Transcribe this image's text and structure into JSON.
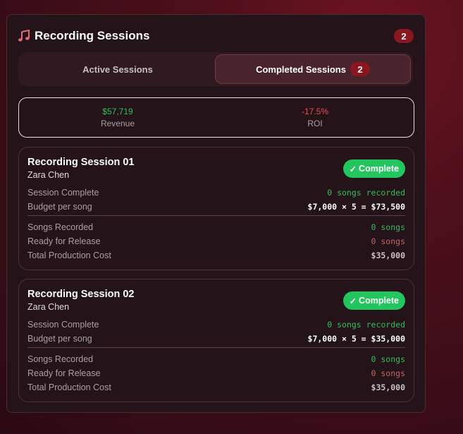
{
  "header": {
    "title": "Recording Sessions",
    "count": "2",
    "icon": "music-note-icon"
  },
  "tabs": [
    {
      "label": "Active Sessions",
      "active": false
    },
    {
      "label": "Completed Sessions",
      "badge": "2",
      "active": true
    }
  ],
  "stats": [
    {
      "value": "$57,719",
      "label": "Revenue",
      "color": "#2fbf5c"
    },
    {
      "value": "-17.5%",
      "label": "ROI",
      "color": "#e0505a"
    }
  ],
  "sessions": [
    {
      "title": "Recording Session 01",
      "artist": "Zara Chen",
      "status": "Complete",
      "status_color": "#22c55e",
      "session_complete_label": "Session Complete",
      "session_complete_value": "0 songs recorded",
      "budget_label": "Budget per song",
      "budget_value": "$7,000 × 5 = $73,500",
      "songs_recorded_label": "Songs Recorded",
      "songs_recorded_value": "0 songs",
      "ready_label": "Ready for Release",
      "ready_value": "0 songs",
      "cost_label": "Total Production Cost",
      "cost_value": "$35,000"
    },
    {
      "title": "Recording Session 02",
      "artist": "Zara Chen",
      "status": "Complete",
      "status_color": "#22c55e",
      "session_complete_label": "Session Complete",
      "session_complete_value": "0 songs recorded",
      "budget_label": "Budget per song",
      "budget_value": "$7,000 × 5 = $35,000",
      "songs_recorded_label": "Songs Recorded",
      "songs_recorded_value": "0 songs",
      "ready_label": "Ready for Release",
      "ready_value": "0 songs",
      "cost_label": "Total Production Cost",
      "cost_value": "$35,000"
    }
  ]
}
